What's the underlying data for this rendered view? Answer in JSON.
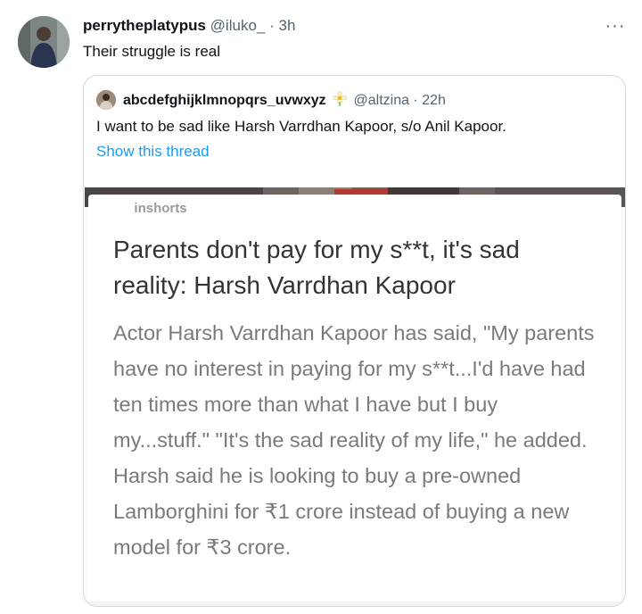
{
  "tweet": {
    "display_name": "perrytheplatypus",
    "handle": "@iluko_",
    "separator": "·",
    "time": "3h",
    "text": "Their struggle is real",
    "more_label": "···"
  },
  "quoted_tweet": {
    "display_name": "abcdefghijklmnopqrs_uvwxyz",
    "handle": "@altzina",
    "separator": "·",
    "time": "22h",
    "text": "I want to be sad like Harsh Varrdhan Kapoor, s/o Anil Kapoor.",
    "show_thread": "Show this thread"
  },
  "card": {
    "brand": "inshorts",
    "headline": "Parents don't pay for my s**t, it's sad reality: Harsh Varrdhan Kapoor",
    "body": "Actor Harsh Varrdhan Kapoor has said, \"My parents have no interest in paying for my s**t...I'd have had ten times more than what I have but I buy my...stuff.\" \"It's the sad reality of my life,\" he added. Harsh said he is looking to buy a pre-owned Lamborghini for ₹1 crore instead of buying a new model for ₹3 crore."
  },
  "colors": {
    "accent_link": "#1d9bf0",
    "secondary_text": "#536471",
    "border": "#cfd9de"
  }
}
